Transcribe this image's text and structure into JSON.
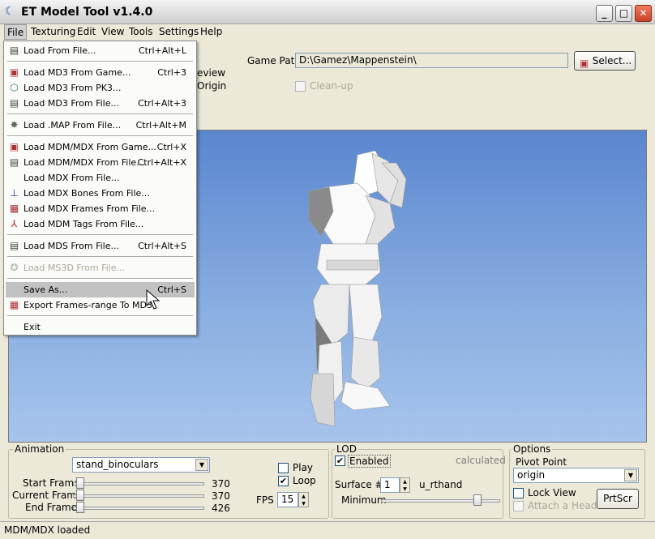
{
  "window": {
    "title": "ET Model Tool v1.4.0",
    "minimize": "_",
    "maximize": "□",
    "close": "✕"
  },
  "menubar": [
    "File",
    "Texturing",
    "Edit",
    "View",
    "Tools",
    "Settings",
    "Help"
  ],
  "file_menu": [
    {
      "label": "Load From File...",
      "shortcut": "Ctrl+Alt+L",
      "icon": "file-icon"
    },
    {
      "label": "Load MD3 From Game...",
      "shortcut": "Ctrl+3",
      "icon": "game-icon"
    },
    {
      "label": "Load MD3 From PK3...",
      "shortcut": "",
      "icon": "pk3-icon"
    },
    {
      "label": "Load MD3 From File...",
      "shortcut": "Ctrl+Alt+3",
      "icon": "file-icon"
    },
    {
      "label": "Load .MAP From File...",
      "shortcut": "Ctrl+Alt+M",
      "icon": "map-icon"
    },
    {
      "label": "Load MDM/MDX From Game...",
      "shortcut": "Ctrl+X",
      "icon": "game-icon"
    },
    {
      "label": "Load MDM/MDX From File...",
      "shortcut": "Ctrl+Alt+X",
      "icon": "file-icon"
    },
    {
      "label": "Load MDX From File...",
      "shortcut": "",
      "icon": ""
    },
    {
      "label": "Load MDX Bones From File...",
      "shortcut": "",
      "icon": "bones-icon"
    },
    {
      "label": "Load MDX Frames From File...",
      "shortcut": "",
      "icon": "frames-icon"
    },
    {
      "label": "Load MDM Tags From File...",
      "shortcut": "",
      "icon": "tags-icon"
    },
    {
      "label": "Load MDS From File...",
      "shortcut": "Ctrl+Alt+S",
      "icon": "file-icon"
    },
    {
      "label": "Load MS3D From File...",
      "shortcut": "",
      "icon": "ms3d-icon"
    },
    {
      "label": "Save As...",
      "shortcut": "Ctrl+S",
      "icon": ""
    },
    {
      "label": "Export Frames-range To MD3",
      "shortcut": "",
      "icon": "frames-icon"
    },
    {
      "label": "Exit",
      "shortcut": "",
      "icon": ""
    }
  ],
  "top": {
    "game_path_label": "Game Path",
    "game_path_value": "D:\\Gamez\\Mappenstein\\",
    "select_button": "Select...",
    "preview_fragment": "eview",
    "origin_fragment": "Origin",
    "cleanup_label": "Clean-up"
  },
  "animation": {
    "group_title": "Animation",
    "selected": "stand_binoculars",
    "start_frame_label": "Start Frame",
    "start_frame_value": "370",
    "current_frame_label": "Current Frame",
    "current_frame_value": "370",
    "end_frame_label": "End Frame",
    "end_frame_value": "426",
    "play_label": "Play",
    "loop_label": "Loop",
    "fps_label": "FPS",
    "fps_value": "15"
  },
  "lod": {
    "group_title": "LOD",
    "enabled_label": "Enabled",
    "calculated_label": "calculated",
    "surface_label": "Surface #",
    "surface_value": "1",
    "surface_name": "u_rthand",
    "minimum_label": "Minimum"
  },
  "options": {
    "group_title": "Options",
    "pivot_label": "Pivot Point",
    "pivot_value": "origin",
    "lock_view_label": "Lock View",
    "attach_head_label": "Attach a Head",
    "prtscr_button": "PrtScr"
  },
  "status": {
    "text": "MDM/MDX loaded"
  },
  "colors": {
    "viewport_top": "#5a86cf",
    "viewport_bottom": "#a7c4ec",
    "highlight": "#c2c2c2"
  }
}
